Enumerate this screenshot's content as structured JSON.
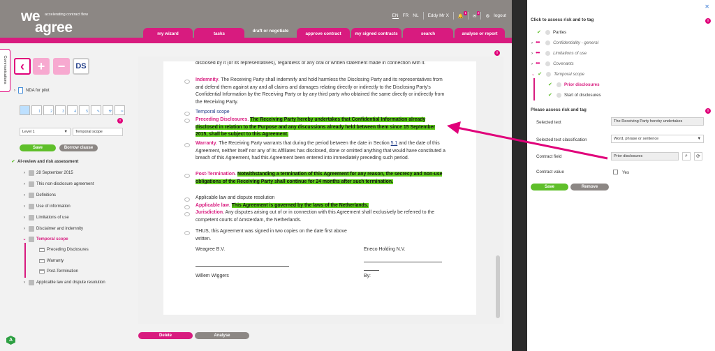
{
  "header": {
    "logo_line1": "we",
    "logo_line2": "agree",
    "tagline": "accelerating contract flow",
    "languages": [
      "EN",
      "FR",
      "NL"
    ],
    "user": "Eddy Mr X",
    "bell_count": "1",
    "mail_count": "2",
    "logout": "logout"
  },
  "tabs": [
    "my wizard",
    "tasks",
    "draft or negotiate",
    "approve contract",
    "my signed contracts",
    "search",
    "analyse or report"
  ],
  "sidebar": {
    "communications": "Communications",
    "doc_name": "NDA for pilot",
    "level_select": "Level 1",
    "temporal_input": "Temporal scope",
    "save": "Save",
    "borrow": "Borrow clause",
    "icons": [
      "1",
      "2",
      "3",
      "4",
      "5"
    ],
    "tree": {
      "root": "AI-review and risk assessment",
      "items": [
        "28 September 2015",
        "This non-disclosure agreement",
        "Definitions",
        "Use of information",
        "Limitations of use",
        "Disclaimer and indemnity",
        "Temporal scope",
        "Applicable law and dispute resolution"
      ],
      "children": [
        "Preceding Disclosures",
        "Warranty",
        "Post-Termination"
      ]
    }
  },
  "document": {
    "p0": "disclosed by it (or its representatives), regardless of any oral or written statement made in connection with it.",
    "indemnity_label": "Indemnity",
    "indemnity_text": ". The Receiving Party shall indemnify and hold harmless the Disclosing Party and its representatives from and defend them against any and all claims and damages relating directly or indirectly to the Disclosing Party's Confidential Information by the Receiving Party or by any third party who obtained the same directly or indirectly from the Receiving Party.",
    "temporal_scope": "Temporal scope",
    "preceding_label": "Preceding Disclosures",
    "preceding_hl": "The Receiving Party hereby undertakes that Confidential Information already disclosed in relation to the Purpose and any discussions already held between them since 15 September 2015, shall be subject to this Agreement.",
    "warranty_label": "Warranty",
    "warranty_text1": ". The Receiving Party warrants that during the period between the date in Section ",
    "warranty_link": "5.1",
    "warranty_text2": " and the date of this Agreement, neither itself nor any of its Affiliates has disclosed, done or omitted anything that would have constituted a breach of this Agreement, had this Agreement been entered into immediately preceding such period.",
    "post_label": "Post-Termination",
    "post_hl": "Notwithstanding a termination of this Agreement for any reason, the secrecy and non-use obligations of the Receiving Party shall continue for 24 months after such termination.",
    "applicable_heading": "Applicable law and dispute resolution",
    "applicable_label": "Applicable law",
    "applicable_hl": "This Agreement is governed by the laws of the Netherlands.",
    "jurisdiction_label": "Jurisdiction",
    "jurisdiction_text": ". Any disputes arising out of or in connection with this Agreement shall exclusively be referred to the competent courts of Amsterdam, the Netherlands.",
    "thus": "THUS, this Agreement was signed in two copies on the date first above written.",
    "party1": "Weagree B.V.",
    "party2": "Eneco Holding N.V.",
    "signer1": "Willem Wiggers",
    "by": "By:"
  },
  "bottom": {
    "delete": "Delete",
    "analyse": "Analyse"
  },
  "avatar": "A",
  "right": {
    "title": "Click to assess risk and to tag",
    "tags": [
      "Parties",
      "Confidentiality - general",
      "Limitations of use",
      "Covenants",
      "Temporal scope",
      "Prior disclosures",
      "Start of disclosures"
    ],
    "assess_title": "Please assess risk and tag",
    "selected_text_label": "Selected text",
    "selected_text_value": "The Receiving Party hereby undertakes",
    "classification_label": "Selected text classification",
    "classification_value": "Word, phrase or sentence",
    "contract_field_label": "Contract field",
    "contract_field_value": "Prior disclosures",
    "contract_value_label": "Contract value",
    "yes": "Yes",
    "save": "Save",
    "remove": "Remove"
  },
  "colors": {
    "brand_pink": "#d81b7f",
    "header_gray": "#8c8784",
    "highlight_green": "#5fcf1a",
    "save_green": "#5fbf2a"
  }
}
